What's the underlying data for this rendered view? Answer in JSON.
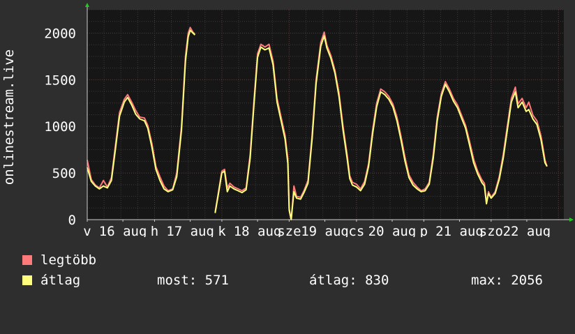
{
  "chart_data": {
    "type": "line",
    "ylabel": "onlinestream.live",
    "ylim": [
      0,
      2250
    ],
    "yticks": [
      0,
      500,
      1000,
      1500,
      2000
    ],
    "x_range": [
      0,
      7.08
    ],
    "x_tick_labels": [
      {
        "x": 0.0,
        "label": "v"
      },
      {
        "x": 0.53,
        "label": "16 aug"
      },
      {
        "x": 1.0,
        "label": "h"
      },
      {
        "x": 1.53,
        "label": "17 aug"
      },
      {
        "x": 2.0,
        "label": "k"
      },
      {
        "x": 2.53,
        "label": "18 aug"
      },
      {
        "x": 3.0,
        "label": "sze"
      },
      {
        "x": 3.53,
        "label": "19 aug"
      },
      {
        "x": 4.0,
        "label": "cs"
      },
      {
        "x": 4.53,
        "label": "20 aug"
      },
      {
        "x": 5.0,
        "label": "p"
      },
      {
        "x": 5.53,
        "label": "21 aug"
      },
      {
        "x": 6.0,
        "label": "szo"
      },
      {
        "x": 6.53,
        "label": "22 aug"
      }
    ],
    "grid": true,
    "series": [
      {
        "name": "legtöbb",
        "color": "#ff7b7b",
        "points": [
          [
            0.0,
            640
          ],
          [
            0.06,
            430
          ],
          [
            0.12,
            370
          ],
          [
            0.18,
            340
          ],
          [
            0.24,
            420
          ],
          [
            0.3,
            350
          ],
          [
            0.36,
            450
          ],
          [
            0.42,
            800
          ],
          [
            0.48,
            1150
          ],
          [
            0.55,
            1290
          ],
          [
            0.6,
            1340
          ],
          [
            0.66,
            1260
          ],
          [
            0.72,
            1170
          ],
          [
            0.78,
            1100
          ],
          [
            0.85,
            1090
          ],
          [
            0.9,
            1010
          ],
          [
            0.96,
            820
          ],
          [
            1.02,
            570
          ],
          [
            1.08,
            460
          ],
          [
            1.14,
            360
          ],
          [
            1.2,
            310
          ],
          [
            1.27,
            330
          ],
          [
            1.33,
            500
          ],
          [
            1.4,
            1000
          ],
          [
            1.46,
            1750
          ],
          [
            1.5,
            2000
          ],
          [
            1.53,
            2060
          ],
          [
            1.57,
            2010
          ],
          [
            1.6,
            1990
          ],
          [
            1.9,
            80
          ],
          [
            1.95,
            300
          ],
          [
            2.0,
            520
          ],
          [
            2.04,
            540
          ],
          [
            2.08,
            340
          ],
          [
            2.12,
            390
          ],
          [
            2.18,
            350
          ],
          [
            2.24,
            330
          ],
          [
            2.3,
            310
          ],
          [
            2.36,
            340
          ],
          [
            2.42,
            700
          ],
          [
            2.48,
            1300
          ],
          [
            2.53,
            1780
          ],
          [
            2.58,
            1880
          ],
          [
            2.64,
            1850
          ],
          [
            2.7,
            1880
          ],
          [
            2.76,
            1700
          ],
          [
            2.82,
            1300
          ],
          [
            2.88,
            1100
          ],
          [
            2.94,
            900
          ],
          [
            2.98,
            650
          ],
          [
            3.0,
            120
          ],
          [
            3.03,
            0
          ],
          [
            3.07,
            360
          ],
          [
            3.11,
            250
          ],
          [
            3.17,
            240
          ],
          [
            3.22,
            310
          ],
          [
            3.28,
            420
          ],
          [
            3.34,
            900
          ],
          [
            3.4,
            1500
          ],
          [
            3.47,
            1900
          ],
          [
            3.52,
            2010
          ],
          [
            3.56,
            1870
          ],
          [
            3.62,
            1760
          ],
          [
            3.68,
            1600
          ],
          [
            3.74,
            1360
          ],
          [
            3.8,
            1000
          ],
          [
            3.86,
            700
          ],
          [
            3.9,
            470
          ],
          [
            3.94,
            400
          ],
          [
            4.0,
            380
          ],
          [
            4.06,
            330
          ],
          [
            4.12,
            410
          ],
          [
            4.18,
            600
          ],
          [
            4.24,
            960
          ],
          [
            4.3,
            1250
          ],
          [
            4.36,
            1400
          ],
          [
            4.42,
            1370
          ],
          [
            4.48,
            1320
          ],
          [
            4.54,
            1240
          ],
          [
            4.6,
            1100
          ],
          [
            4.66,
            900
          ],
          [
            4.72,
            670
          ],
          [
            4.78,
            480
          ],
          [
            4.84,
            400
          ],
          [
            4.9,
            350
          ],
          [
            4.96,
            310
          ],
          [
            5.02,
            330
          ],
          [
            5.08,
            400
          ],
          [
            5.14,
            700
          ],
          [
            5.2,
            1100
          ],
          [
            5.26,
            1350
          ],
          [
            5.32,
            1480
          ],
          [
            5.38,
            1400
          ],
          [
            5.44,
            1300
          ],
          [
            5.5,
            1230
          ],
          [
            5.56,
            1120
          ],
          [
            5.62,
            1010
          ],
          [
            5.68,
            840
          ],
          [
            5.74,
            650
          ],
          [
            5.8,
            520
          ],
          [
            5.86,
            430
          ],
          [
            5.9,
            390
          ],
          [
            5.93,
            180
          ],
          [
            5.96,
            300
          ],
          [
            6.0,
            240
          ],
          [
            6.06,
            300
          ],
          [
            6.12,
            460
          ],
          [
            6.18,
            700
          ],
          [
            6.24,
            1000
          ],
          [
            6.3,
            1300
          ],
          [
            6.36,
            1420
          ],
          [
            6.4,
            1240
          ],
          [
            6.46,
            1300
          ],
          [
            6.52,
            1200
          ],
          [
            6.56,
            1260
          ],
          [
            6.62,
            1120
          ],
          [
            6.68,
            1060
          ],
          [
            6.74,
            900
          ],
          [
            6.8,
            640
          ],
          [
            6.83,
            570
          ]
        ]
      },
      {
        "name": "átlag",
        "color": "#ffff7d",
        "points": [
          [
            0.0,
            560
          ],
          [
            0.06,
            410
          ],
          [
            0.12,
            360
          ],
          [
            0.18,
            330
          ],
          [
            0.24,
            360
          ],
          [
            0.3,
            340
          ],
          [
            0.36,
            420
          ],
          [
            0.42,
            760
          ],
          [
            0.48,
            1110
          ],
          [
            0.55,
            1260
          ],
          [
            0.6,
            1310
          ],
          [
            0.66,
            1230
          ],
          [
            0.72,
            1130
          ],
          [
            0.78,
            1080
          ],
          [
            0.85,
            1060
          ],
          [
            0.9,
            980
          ],
          [
            0.96,
            780
          ],
          [
            1.02,
            540
          ],
          [
            1.08,
            420
          ],
          [
            1.14,
            330
          ],
          [
            1.2,
            300
          ],
          [
            1.27,
            320
          ],
          [
            1.33,
            460
          ],
          [
            1.4,
            960
          ],
          [
            1.46,
            1700
          ],
          [
            1.5,
            1960
          ],
          [
            1.53,
            2030
          ],
          [
            1.57,
            2000
          ],
          [
            1.6,
            1980
          ],
          [
            1.9,
            70
          ],
          [
            1.95,
            280
          ],
          [
            2.0,
            500
          ],
          [
            2.04,
            520
          ],
          [
            2.08,
            300
          ],
          [
            2.12,
            360
          ],
          [
            2.18,
            330
          ],
          [
            2.24,
            310
          ],
          [
            2.3,
            290
          ],
          [
            2.36,
            320
          ],
          [
            2.42,
            660
          ],
          [
            2.48,
            1260
          ],
          [
            2.53,
            1740
          ],
          [
            2.58,
            1850
          ],
          [
            2.64,
            1820
          ],
          [
            2.7,
            1840
          ],
          [
            2.76,
            1660
          ],
          [
            2.82,
            1260
          ],
          [
            2.88,
            1060
          ],
          [
            2.94,
            860
          ],
          [
            2.98,
            600
          ],
          [
            3.0,
            100
          ],
          [
            3.03,
            0
          ],
          [
            3.07,
            300
          ],
          [
            3.11,
            230
          ],
          [
            3.17,
            220
          ],
          [
            3.22,
            290
          ],
          [
            3.28,
            390
          ],
          [
            3.34,
            860
          ],
          [
            3.4,
            1460
          ],
          [
            3.47,
            1860
          ],
          [
            3.52,
            1970
          ],
          [
            3.56,
            1840
          ],
          [
            3.62,
            1730
          ],
          [
            3.68,
            1570
          ],
          [
            3.74,
            1320
          ],
          [
            3.8,
            960
          ],
          [
            3.86,
            660
          ],
          [
            3.9,
            440
          ],
          [
            3.94,
            370
          ],
          [
            4.0,
            350
          ],
          [
            4.06,
            310
          ],
          [
            4.12,
            380
          ],
          [
            4.18,
            570
          ],
          [
            4.24,
            920
          ],
          [
            4.3,
            1210
          ],
          [
            4.36,
            1370
          ],
          [
            4.42,
            1340
          ],
          [
            4.48,
            1290
          ],
          [
            4.54,
            1210
          ],
          [
            4.6,
            1060
          ],
          [
            4.66,
            860
          ],
          [
            4.72,
            630
          ],
          [
            4.78,
            450
          ],
          [
            4.84,
            370
          ],
          [
            4.9,
            330
          ],
          [
            4.96,
            300
          ],
          [
            5.02,
            310
          ],
          [
            5.08,
            380
          ],
          [
            5.14,
            660
          ],
          [
            5.2,
            1060
          ],
          [
            5.26,
            1320
          ],
          [
            5.32,
            1450
          ],
          [
            5.38,
            1370
          ],
          [
            5.44,
            1270
          ],
          [
            5.5,
            1200
          ],
          [
            5.56,
            1090
          ],
          [
            5.62,
            980
          ],
          [
            5.68,
            800
          ],
          [
            5.74,
            610
          ],
          [
            5.8,
            490
          ],
          [
            5.86,
            400
          ],
          [
            5.9,
            360
          ],
          [
            5.93,
            170
          ],
          [
            5.96,
            280
          ],
          [
            6.0,
            230
          ],
          [
            6.06,
            280
          ],
          [
            6.12,
            430
          ],
          [
            6.18,
            660
          ],
          [
            6.24,
            960
          ],
          [
            6.3,
            1260
          ],
          [
            6.36,
            1370
          ],
          [
            6.4,
            1200
          ],
          [
            6.46,
            1260
          ],
          [
            6.52,
            1160
          ],
          [
            6.56,
            1180
          ],
          [
            6.62,
            1080
          ],
          [
            6.68,
            1020
          ],
          [
            6.74,
            860
          ],
          [
            6.8,
            610
          ],
          [
            6.83,
            571
          ]
        ]
      }
    ]
  },
  "legend": {
    "items": [
      {
        "label": "legtöbb",
        "color": "#ff7b7b"
      },
      {
        "label": "átlag",
        "color": "#ffff7d"
      }
    ],
    "stats": {
      "now": "most: 571",
      "avg": "átlag: 830",
      "max": "max: 2056"
    }
  },
  "colors": {
    "background": "#2e2e2e",
    "plot_background": "#161616",
    "grid_major": "#5a3a3a",
    "grid_minor": "#3a3a3a",
    "axis_arrow": "#22cc22"
  }
}
